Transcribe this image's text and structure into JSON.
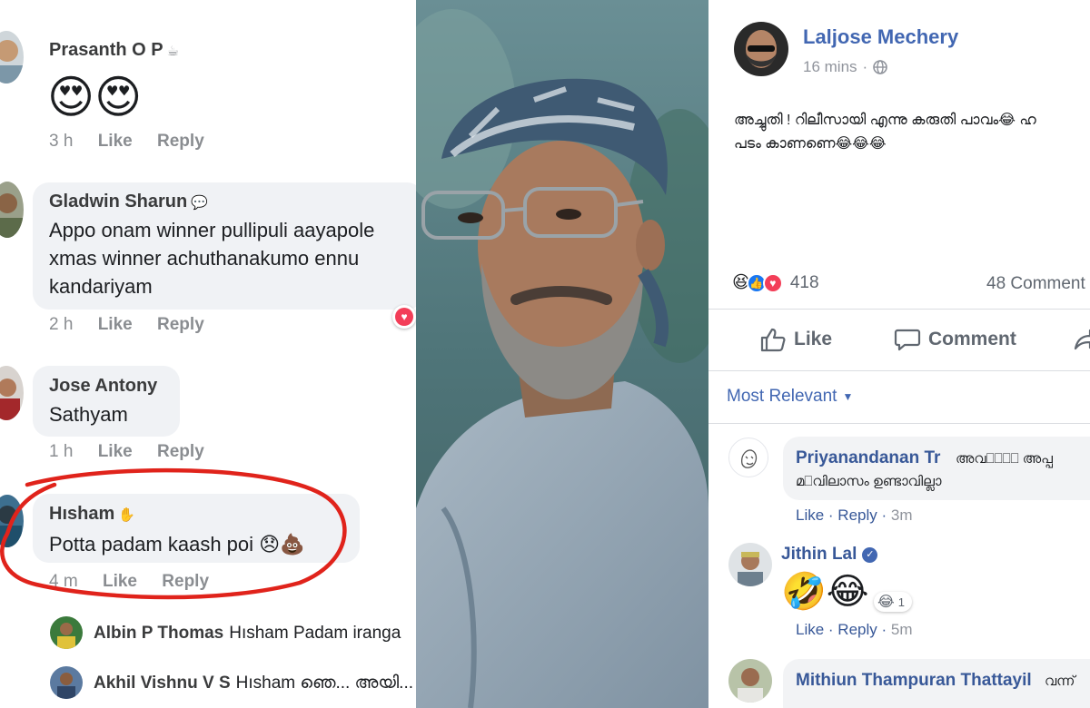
{
  "left": {
    "comments": [
      {
        "name": "Prasanth O P",
        "emoji": "😍😍",
        "time": "3 h",
        "like": "Like",
        "reply": "Reply"
      },
      {
        "name": "Gladwin Sharun",
        "lines": [
          "Appo onam winner pullipuli aayapole",
          "xmas winner achuthanakumo ennu",
          "kandariyam"
        ],
        "time": "2 h",
        "like": "Like",
        "reply": "Reply"
      },
      {
        "name": "Jose Antony",
        "lines": [
          "Sathyam"
        ],
        "time": "1 h",
        "like": "Like",
        "reply": "Reply"
      },
      {
        "name": "Hısham",
        "lines": [
          "Potta padam kaash poi 😞💩"
        ],
        "time": "4 m",
        "like": "Like",
        "reply": "Reply"
      }
    ],
    "replies": [
      {
        "name": "Albin P Thomas",
        "text": "Hısham Padam iranga"
      },
      {
        "name": "Akhil Vishnu V S",
        "text": "Hısham ഞെ... അയി..."
      }
    ],
    "highlight_color": "#e0231b"
  },
  "post": {
    "author": "Laljose Mechery",
    "time": "16 mins",
    "text_line1": "അച്ചുതി ! റിലീസായി എന്നു കരുതി പാവം😂 ഹ",
    "text_line2": "പടം കാണണെ😂😂😂",
    "reaction_count": "418",
    "comments_count": "48 Comment",
    "actions": {
      "like": "Like",
      "comment": "Comment"
    },
    "sort_label": "Most Relevant"
  },
  "right_comments": [
    {
      "name": "Priyanandanan Tr",
      "text1": "അവ⎕⎕⎕⎕ അപ്പ",
      "text2": "മ⎕വിലാസം ഉണ്ടാവില്ലാ",
      "like": "Like",
      "reply": "Reply",
      "time": "3m"
    },
    {
      "name": "Jithin Lal",
      "emoji": "🤣😂",
      "reaction_count": "1",
      "like": "Like",
      "reply": "Reply",
      "time": "5m"
    },
    {
      "name": "Mithiun Thampuran Thattayil",
      "text1": "വന്ന്"
    }
  ],
  "colors": {
    "fb_blue": "#385898",
    "link_blue": "#4267b2"
  }
}
